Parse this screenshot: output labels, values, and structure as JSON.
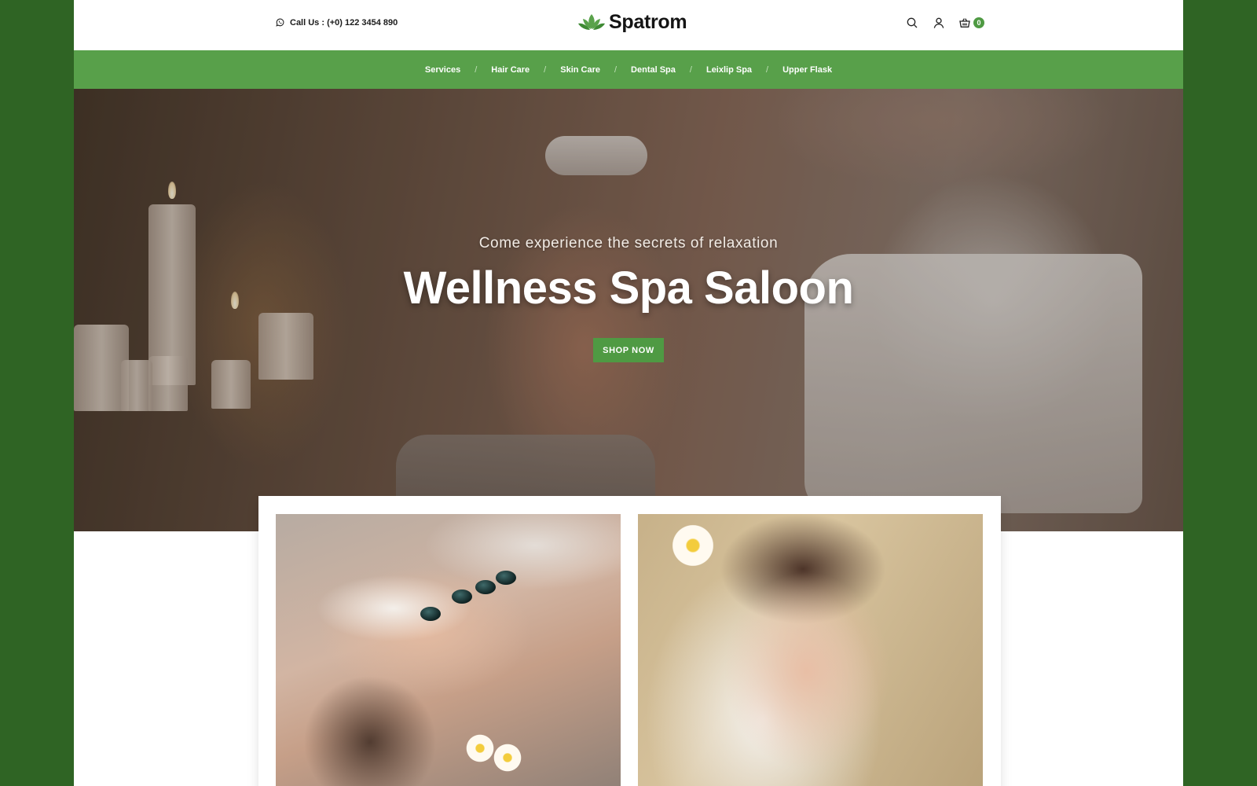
{
  "header": {
    "call_label": "Call Us : (+0) 122 3454 890",
    "brand": "Spatrom",
    "cart_count": "0",
    "icons": [
      "whatsapp-icon",
      "lotus-logo-icon",
      "search-icon",
      "user-icon",
      "cart-icon"
    ]
  },
  "nav": {
    "items": [
      {
        "label": "Services"
      },
      {
        "label": "Hair Care"
      },
      {
        "label": "Skin Care"
      },
      {
        "label": "Dental Spa"
      },
      {
        "label": "Leixlip Spa"
      },
      {
        "label": "Upper Flask"
      }
    ],
    "separator": "/"
  },
  "hero": {
    "subtitle": "Come experience the secrets of relaxation",
    "title": "Wellness Spa Saloon",
    "cta": "SHOP NOW"
  },
  "colors": {
    "background": "#2f6424",
    "nav": "#58a04a",
    "accent": "#4f9a43"
  }
}
